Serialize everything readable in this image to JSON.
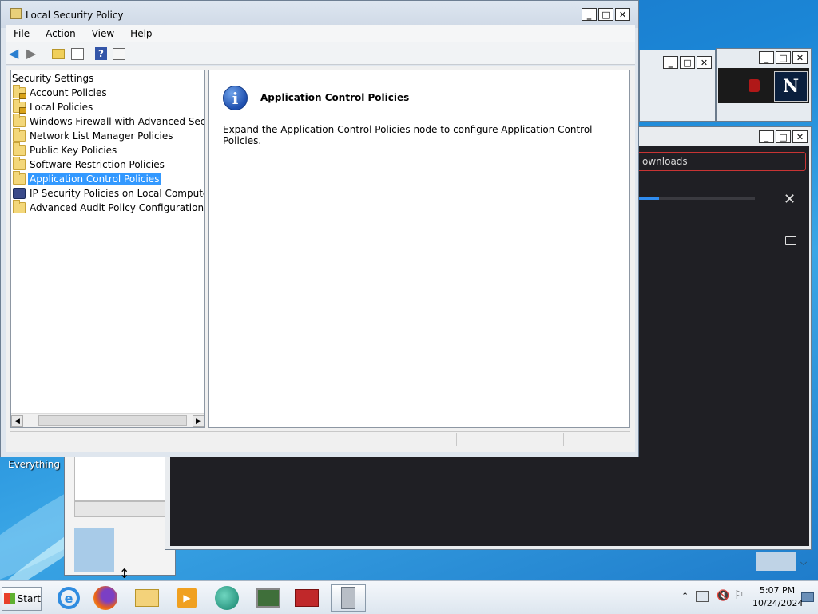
{
  "main_window": {
    "title": "Local Security Policy",
    "menu": [
      "File",
      "Action",
      "View",
      "Help"
    ],
    "tree": {
      "root": "Security Settings",
      "items": [
        {
          "label": "Account Policies",
          "icon": "folder-lock-icon"
        },
        {
          "label": "Local Policies",
          "icon": "folder-lock-icon"
        },
        {
          "label": "Windows Firewall with Advanced Security",
          "icon": "folder-icon"
        },
        {
          "label": "Network List Manager Policies",
          "icon": "folder-icon"
        },
        {
          "label": "Public Key Policies",
          "icon": "folder-icon"
        },
        {
          "label": "Software Restriction Policies",
          "icon": "folder-icon"
        },
        {
          "label": "Application Control Policies",
          "icon": "folder-icon",
          "selected": true
        },
        {
          "label": "IP Security Policies on Local Computer",
          "icon": "ip-security-icon"
        },
        {
          "label": "Advanced Audit Policy Configuration",
          "icon": "folder-icon"
        }
      ]
    },
    "detail": {
      "heading": "Application Control Policies",
      "description": "Expand the Application Control Policies node to configure Application Control Policies."
    }
  },
  "background": {
    "downloads_search_text": "ownloads",
    "desktop_icon_label": "Everything"
  },
  "taskbar": {
    "start_label": "Start",
    "clock_time": "5:07 PM",
    "clock_date": "10/24/2024"
  },
  "colors": {
    "selection": "#3399ff",
    "dark_panel": "#1f1f24",
    "desktop_blue": "#1b86d6"
  }
}
